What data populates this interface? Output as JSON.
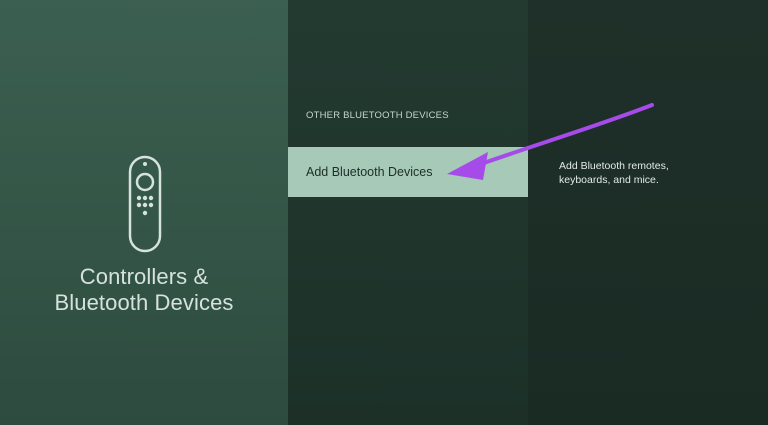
{
  "left_panel": {
    "icon": "remote-control-icon",
    "title_line1": "Controllers &",
    "title_line2": "Bluetooth Devices"
  },
  "middle_panel": {
    "section_header": "OTHER BLUETOOTH DEVICES",
    "items": [
      {
        "label": "Add Bluetooth Devices",
        "selected": true
      }
    ]
  },
  "right_panel": {
    "description_line1": "Add Bluetooth remotes,",
    "description_line2": "keyboards, and mice."
  },
  "colors": {
    "left_panel_bg": "#3b5f51",
    "middle_panel_bg": "#233a31",
    "right_panel_bg": "#1e3029",
    "selected_item_bg": "#a6c9b8",
    "annotation_arrow": "#a64bea"
  },
  "annotation": {
    "type": "arrow",
    "points_to": "Add Bluetooth Devices"
  }
}
